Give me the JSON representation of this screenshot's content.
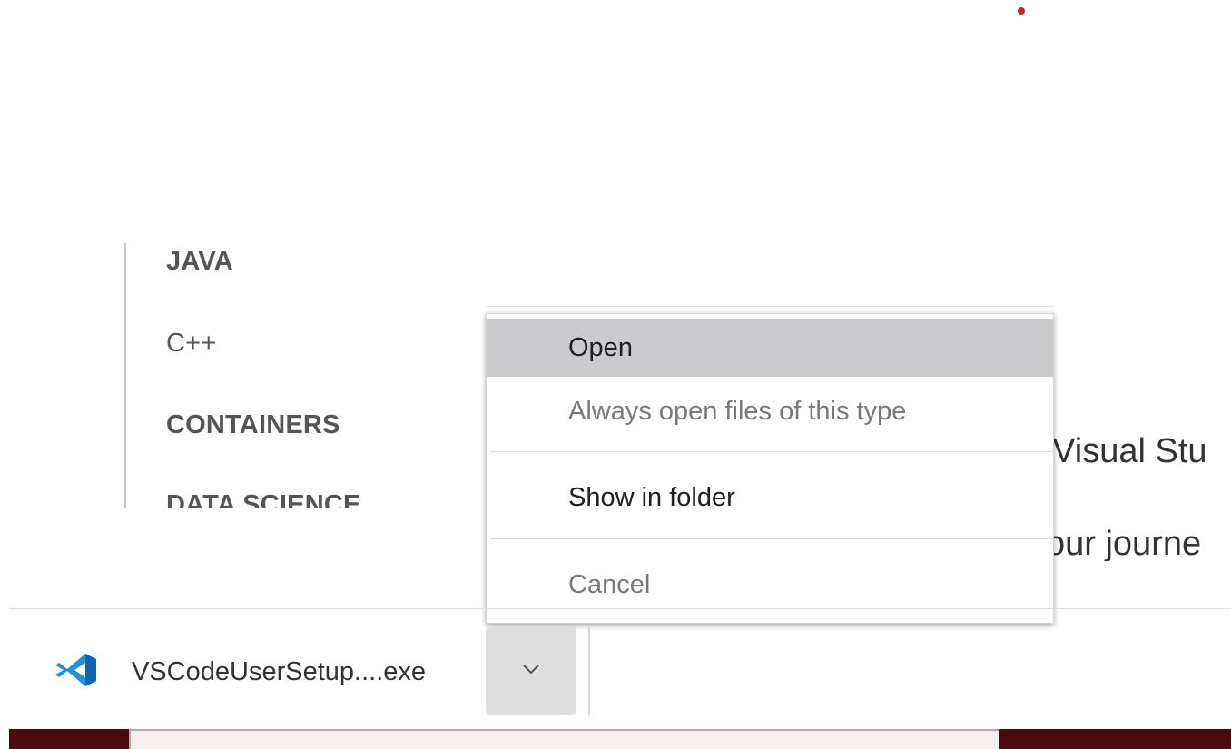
{
  "colors": {
    "red_dot": "#c0272d",
    "taskbar_dark": "#4a0b0e",
    "vscode_blue": "#1f8fe0",
    "vscode_dark_blue": "#0e64b0"
  },
  "side_nav": {
    "items": [
      {
        "label": "JAVA"
      },
      {
        "label": "C++"
      },
      {
        "label": "CONTAINERS"
      },
      {
        "label": "DATA SCIENCE"
      }
    ]
  },
  "background_text": {
    "line1": "f Visual Stu",
    "line2": "our journe"
  },
  "context_menu": {
    "items": [
      {
        "label": "Open",
        "state": "highlighted"
      },
      {
        "label": "Always open files of this type",
        "state": "disabled"
      },
      {
        "label": "Show in folder",
        "state": "enabled"
      },
      {
        "label": "Cancel",
        "state": "disabled"
      }
    ]
  },
  "download_shelf": {
    "file_name": "VSCodeUserSetup....exe",
    "icon": "vscode-icon",
    "menu_button_icon": "chevron-down-icon"
  }
}
